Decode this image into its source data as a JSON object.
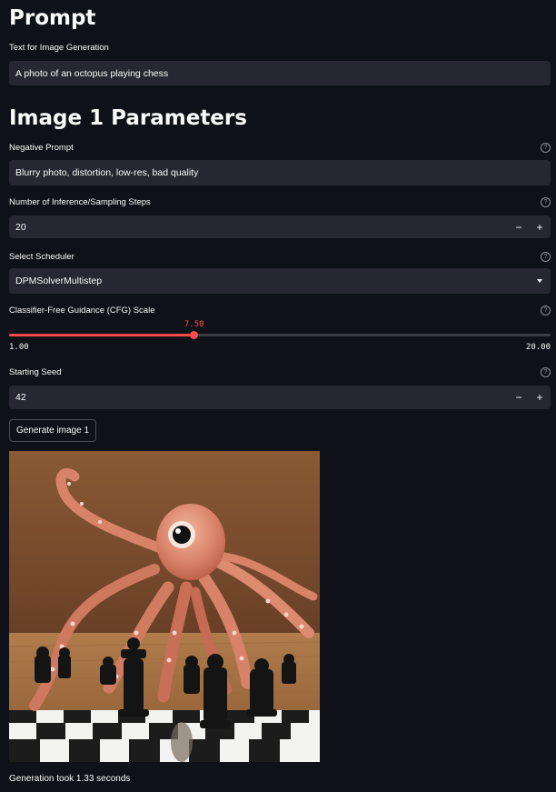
{
  "prompt_section": {
    "heading": "Prompt",
    "text_label": "Text for Image Generation",
    "text_value": "A photo of an octopus playing chess"
  },
  "params_section": {
    "heading": "Image 1 Parameters",
    "negative_prompt": {
      "label": "Negative Prompt",
      "value": "Blurry photo, distortion, low-res, bad quality"
    },
    "steps": {
      "label": "Number of Inference/Sampling Steps",
      "value": "20",
      "minus": "−",
      "plus": "+"
    },
    "scheduler": {
      "label": "Select Scheduler",
      "value": "DPMSolverMultistep"
    },
    "cfg": {
      "label": "Classifier-Free Guidance (CFG) Scale",
      "value": "7.50",
      "min": "1.00",
      "max": "20.00",
      "fraction": 0.3421
    },
    "seed": {
      "label": "Starting Seed",
      "value": "42",
      "minus": "−",
      "plus": "+"
    },
    "generate_button": "Generate image 1",
    "result_caption": "Generation took 1.33 seconds"
  },
  "help_icon": "?",
  "colors": {
    "background": "#0e1117",
    "input_bg": "#262730",
    "accent": "#ff4b4b"
  }
}
